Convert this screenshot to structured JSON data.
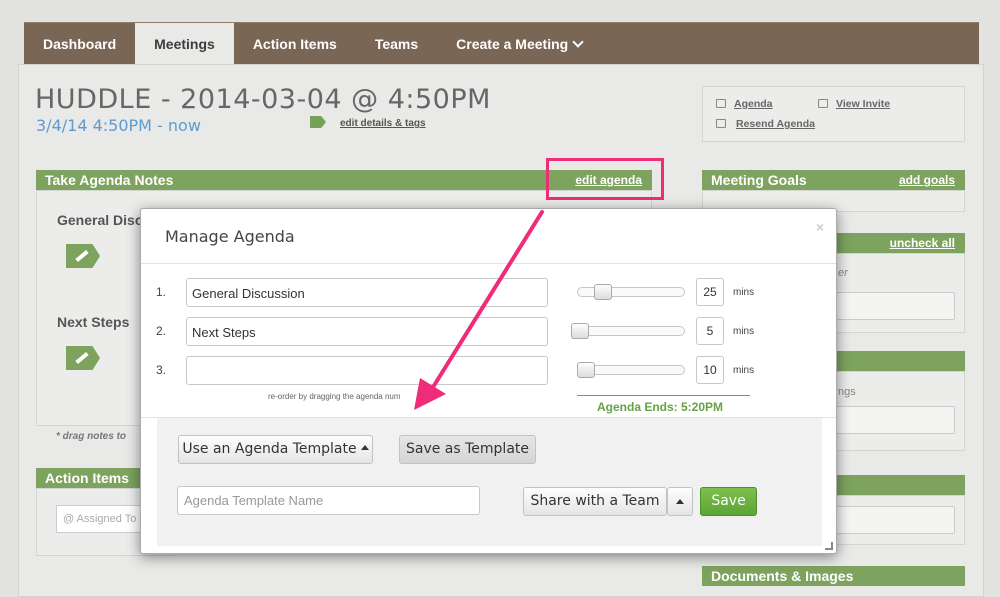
{
  "nav": {
    "tabs": [
      "Dashboard",
      "Meetings",
      "Action Items",
      "Teams",
      "Create a Meeting"
    ]
  },
  "meeting": {
    "title": "HUDDLE - 2014-03-04 @ 4:50PM",
    "datetime": "3/4/14 4:50PM - now",
    "edit_details": "edit details & tags"
  },
  "links": {
    "agenda": "Agenda",
    "view_invite": "View Invite",
    "resend": "Resend Agenda"
  },
  "notes_panel": {
    "title": "Take Agenda Notes",
    "edit_link": "edit agenda",
    "item1": "General Disc",
    "item2": "Next Steps",
    "drag_note": "* drag notes to"
  },
  "action_panel": {
    "title": "Action Items",
    "assigned": "Assigned To"
  },
  "right": {
    "goals_title": "Meeting Goals",
    "goals_link": "add goals",
    "uncheck_link": "uncheck all",
    "ghost1": "er",
    "ghost2": "ngs",
    "docs_title": "Documents & Images"
  },
  "modal": {
    "title": "Manage Agenda",
    "close": "×",
    "rows": [
      {
        "num": "1.",
        "name": "General Discussion",
        "mins": "25",
        "fill": 0.25
      },
      {
        "num": "2.",
        "name": "Next Steps",
        "mins": "5",
        "fill": 0.0
      },
      {
        "num": "3.",
        "name": "",
        "mins": "10",
        "fill": 0.0
      }
    ],
    "mins_label": "mins",
    "reorder_hint": "re-order by dragging the agenda num",
    "ends": "Agenda Ends: 5:20PM",
    "use_template": "Use an Agenda Template",
    "save_template": "Save as Template",
    "template_placeholder": "Agenda Template Name",
    "share": "Share with a Team",
    "save": "Save"
  },
  "colors": {
    "accent_green": "#7da35f",
    "nav_brown": "#7a6655",
    "highlight_pink": "#ef2c7a",
    "link_blue": "#5d9bd2"
  }
}
